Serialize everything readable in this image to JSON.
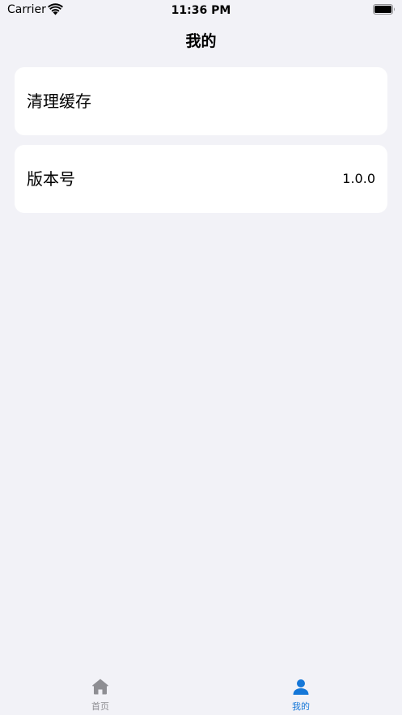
{
  "status_bar": {
    "carrier": "Carrier",
    "time": "11:36 PM",
    "wifi_icon": "wifi-icon",
    "battery_icon": "battery-icon"
  },
  "nav": {
    "title": "我的"
  },
  "settings": {
    "items": [
      {
        "label": "清理缓存",
        "value": ""
      },
      {
        "label": "版本号",
        "value": "1.0.0"
      }
    ]
  },
  "tab_bar": {
    "tabs": [
      {
        "label": "首页",
        "icon": "house-icon",
        "selected": false
      },
      {
        "label": "我的",
        "icon": "person-icon",
        "selected": true
      }
    ],
    "colors": {
      "active": "#1577d8",
      "inactive": "#8e8e93"
    }
  }
}
